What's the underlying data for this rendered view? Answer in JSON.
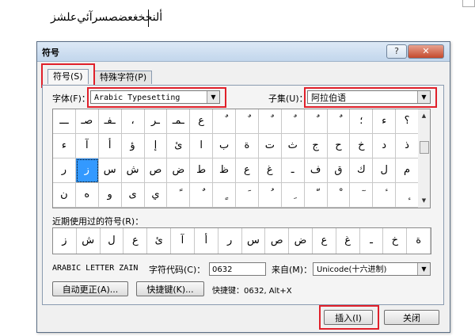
{
  "document": {
    "text": "ﺃﻟﻨﺨﺨﻐﻌﻀﺼﺴﺮﺁﺋﻲﻋﻠﺸﺰ"
  },
  "dialog": {
    "title": "符号",
    "help_glyph": "?",
    "close_glyph": "✕",
    "tabs": [
      {
        "label": "符号(S)"
      },
      {
        "label": "特殊字符(P)"
      }
    ],
    "font": {
      "label": "字体(F)：",
      "value": "Arabic Typesetting"
    },
    "subset": {
      "label": "子集(U)：",
      "value": "阿拉伯语"
    },
    "symbol_rows": [
      [
        "ـــ",
        "صـ",
        "ـفـ",
        "،",
        "ـر",
        "ـمـ",
        "ع",
        "ٌ",
        "ٌ",
        "ٌ",
        "ٌ",
        "ٌ",
        "ٌ",
        "؛",
        "ء",
        "؟"
      ],
      [
        "ء",
        "آ",
        "أ",
        "ؤ",
        "إ",
        "ئ",
        "ا",
        "ب",
        "ة",
        "ت",
        "ث",
        "ج",
        "ح",
        "خ",
        "د",
        "ذ"
      ],
      [
        "ر",
        "ز",
        "س",
        "ش",
        "ص",
        "ض",
        "ط",
        "ظ",
        "ع",
        "غ",
        "ـ",
        "ف",
        "ق",
        "ك",
        "ل",
        "م"
      ],
      [
        "ن",
        "ه",
        "و",
        "ى",
        "ي",
        "ً",
        "ٌ",
        "ٍ",
        "َ",
        "ُ",
        "ِ",
        "ّ",
        "ْ",
        "ٓ",
        "ٔ",
        "ٕ"
      ]
    ],
    "recent_label": "近期使用过的符号(R)：",
    "recent_symbols": [
      "ز",
      "ش",
      "ل",
      "ع",
      "ئ",
      "آ",
      "أ",
      "ر",
      "س",
      "ص",
      "ض",
      "ع",
      "غ",
      "ـ",
      "خ",
      "ة"
    ],
    "char_name": "ARABIC LETTER ZAIN",
    "char_code_label": "字符代码(C)：",
    "char_code_value": "0632",
    "from_label": "来自(M)：",
    "from_value": "Unicode(十六进制)",
    "autocorrect_button": "自动更正(A)...",
    "shortcut_button": "快捷键(K)...",
    "shortcut_info": "快捷键：0632, Alt+X",
    "insert_button": "插入(I)",
    "close_button": "关闭"
  },
  "colors": {
    "highlight": "#e0202a",
    "selection": "#3399ff",
    "dialog_bg": "#f0f0f0"
  }
}
